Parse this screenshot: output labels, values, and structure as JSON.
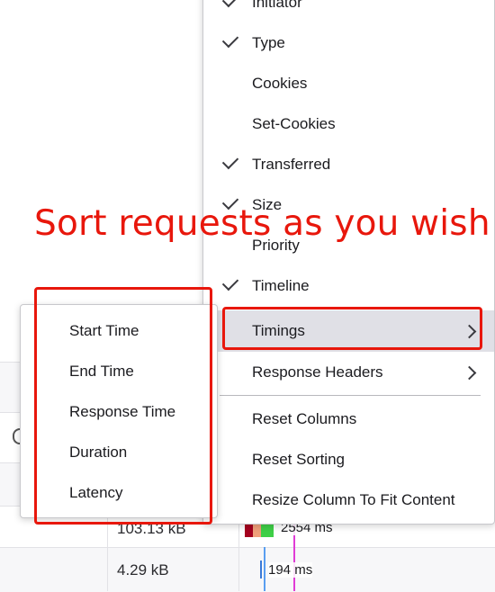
{
  "menu": {
    "items": [
      {
        "label": "Initiator",
        "checked": true,
        "submenu": false
      },
      {
        "label": "Type",
        "checked": true,
        "submenu": false
      },
      {
        "label": "Cookies",
        "checked": false,
        "submenu": false
      },
      {
        "label": "Set-Cookies",
        "checked": false,
        "submenu": false
      },
      {
        "label": "Transferred",
        "checked": true,
        "submenu": false
      },
      {
        "label": "Size",
        "checked": true,
        "submenu": false
      },
      {
        "label": "Priority",
        "checked": false,
        "submenu": false
      },
      {
        "label": "Timeline",
        "checked": true,
        "submenu": false
      },
      {
        "label": "Timings",
        "checked": false,
        "submenu": true,
        "hovered": true
      },
      {
        "label": "Response Headers",
        "checked": false,
        "submenu": true
      }
    ],
    "actions": [
      {
        "label": "Reset Columns"
      },
      {
        "label": "Reset Sorting"
      },
      {
        "label": "Resize Column To Fit Content"
      }
    ]
  },
  "submenu": {
    "items": [
      {
        "label": "Start Time"
      },
      {
        "label": "End Time"
      },
      {
        "label": "Response Time"
      },
      {
        "label": "Duration"
      },
      {
        "label": "Latency"
      }
    ]
  },
  "annotation": {
    "text": "Sort requests as you wish",
    "color": "#e8170c"
  },
  "table": {
    "rows": [
      {
        "size": "103.13 kB",
        "duration": "2554 ms"
      },
      {
        "size": "4.29 kB",
        "duration": "194 ms"
      }
    ]
  },
  "colors": {
    "hover": "#e0e0e6",
    "waterfall_blocked": "#a5001e",
    "waterfall_connect": "#f0a07a",
    "waterfall_receive": "#3fcf47",
    "dom_content_loaded": "#5a9ef0",
    "load": "#e03cd6"
  }
}
